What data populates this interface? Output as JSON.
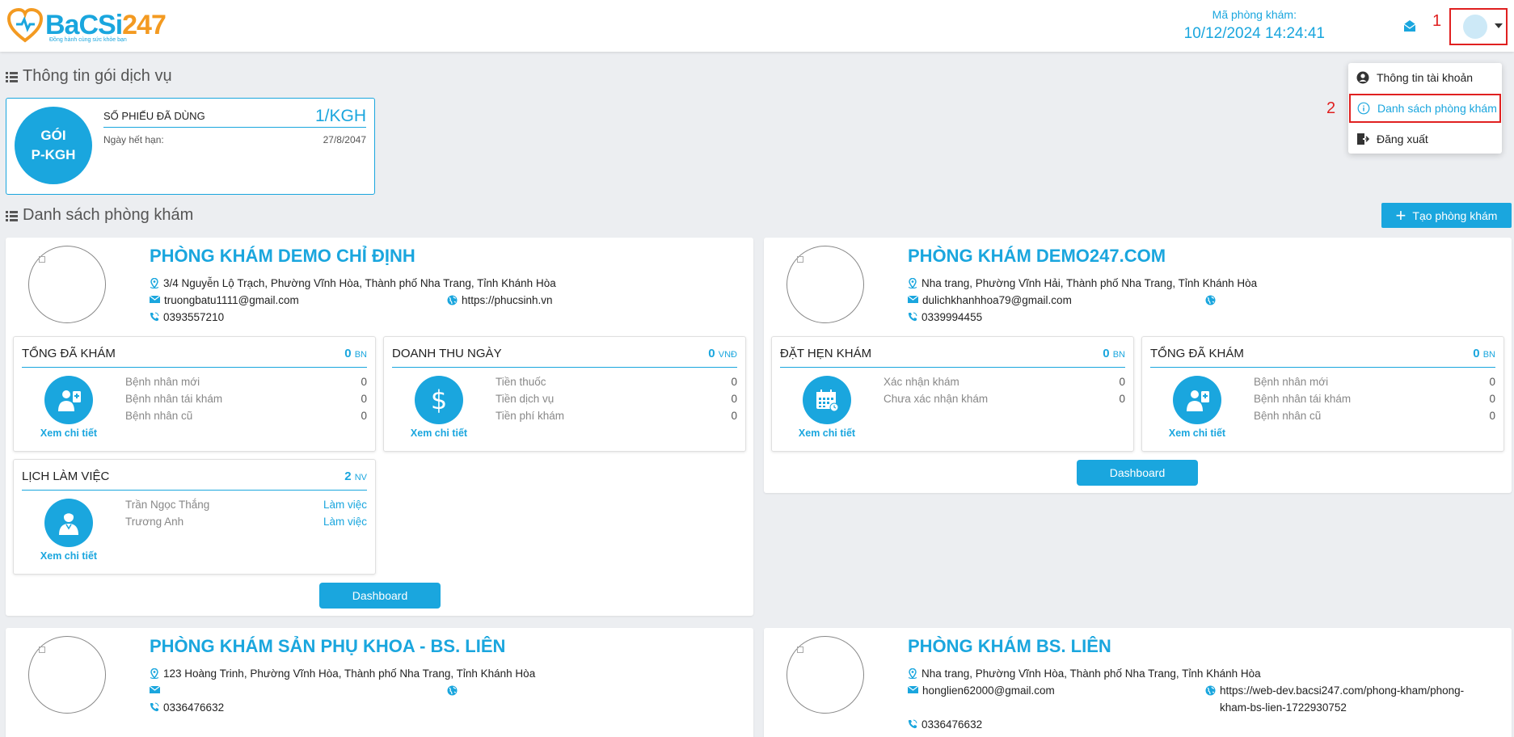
{
  "header": {
    "logo_text_main": "BaCSi",
    "logo_text_num": "247",
    "logo_tagline": "Đồng hành cùng sức khỏe bạn",
    "clinic_code_label": "Mã phòng khám:",
    "datetime": "10/12/2024 14:24:41",
    "annotation_1": "1",
    "annotation_2": "2"
  },
  "dropdown": {
    "items": [
      {
        "label": "Thông tin tài khoản",
        "icon": "account-icon"
      },
      {
        "label": "Danh sách phòng khám",
        "icon": "info-icon"
      },
      {
        "label": "Đăng xuất",
        "icon": "logout-icon"
      }
    ]
  },
  "package_section": {
    "title": "Thông tin gói dịch vụ",
    "circle_line1": "GÓI",
    "circle_line2": "P-KGH",
    "used_label": "SỐ PHIẾU ĐÃ DÙNG",
    "used_value": "1/KGH",
    "expiry_label": "Ngày hết hạn:",
    "expiry_value": "27/8/2047"
  },
  "clinic_section": {
    "title": "Danh sách phòng khám",
    "create_button": "Tạo phòng khám"
  },
  "common": {
    "view_detail": "Xem chi tiết",
    "dashboard": "Dashboard",
    "unit_bn": "BN",
    "unit_vnd": "VNĐ",
    "unit_nv": "NV"
  },
  "clinics": [
    {
      "name": "PHÒNG KHÁM DEMO CHỈ ĐỊNH",
      "address": "3/4 Nguyễn Lộ Trạch, Phường Vĩnh Hòa, Thành phố Nha Trang, Tỉnh Khánh Hòa",
      "email": "truongbatu1111@gmail.com",
      "website": "https://phucsinh.vn",
      "phone": "0393557210",
      "total_exam": {
        "title": "TỔNG ĐÃ KHÁM",
        "count": "0",
        "rows": [
          [
            "Bệnh nhân mới",
            "0"
          ],
          [
            "Bệnh nhân tái khám",
            "0"
          ],
          [
            "Bệnh nhân cũ",
            "0"
          ]
        ]
      },
      "revenue": {
        "title": "DOANH THU NGÀY",
        "count": "0",
        "rows": [
          [
            "Tiền thuốc",
            "0"
          ],
          [
            "Tiền dịch vụ",
            "0"
          ],
          [
            "Tiền phí khám",
            "0"
          ]
        ]
      },
      "schedule": {
        "title": "LỊCH LÀM VIỆC",
        "count": "2",
        "rows": [
          [
            "Trần Ngọc Thắng",
            "Làm việc"
          ],
          [
            "Trương Anh",
            "Làm việc"
          ]
        ]
      }
    },
    {
      "name": "PHÒNG KHÁM DEMO247.COM",
      "address": "Nha trang, Phường Vĩnh Hải, Thành phố Nha Trang, Tỉnh Khánh Hòa",
      "email": "dulichkhanhhoa79@gmail.com",
      "website": "",
      "phone": "0339994455",
      "appointments": {
        "title": "ĐẶT HẸN KHÁM",
        "count": "0",
        "rows": [
          [
            "Xác nhận khám",
            "0"
          ],
          [
            "Chưa xác nhận khám",
            "0"
          ]
        ]
      },
      "total_exam": {
        "title": "TỔNG ĐÃ KHÁM",
        "count": "0",
        "rows": [
          [
            "Bệnh nhân mới",
            "0"
          ],
          [
            "Bệnh nhân tái khám",
            "0"
          ],
          [
            "Bệnh nhân cũ",
            "0"
          ]
        ]
      }
    },
    {
      "name": "PHÒNG KHÁM SẢN PHỤ KHOA - BS. LIÊN",
      "address": "123 Hoàng Trinh, Phường Vĩnh Hòa, Thành phố Nha Trang, Tỉnh Khánh Hòa",
      "email": "",
      "website": "",
      "phone": "0336476632"
    },
    {
      "name": "PHÒNG KHÁM BS. LIÊN",
      "address": "Nha trang, Phường Vĩnh Hòa, Thành phố Nha Trang, Tỉnh Khánh Hòa",
      "email": "honglien62000@gmail.com",
      "website_line1": "https://web-dev.bacsi247.com/phong-kham/phong-",
      "website_line2": "kham-bs-lien-1722930752",
      "phone": "0336476632"
    }
  ],
  "colors": {
    "accent": "#1aa6de",
    "annotation": "#e02020",
    "brand_orange": "#f39a21"
  }
}
